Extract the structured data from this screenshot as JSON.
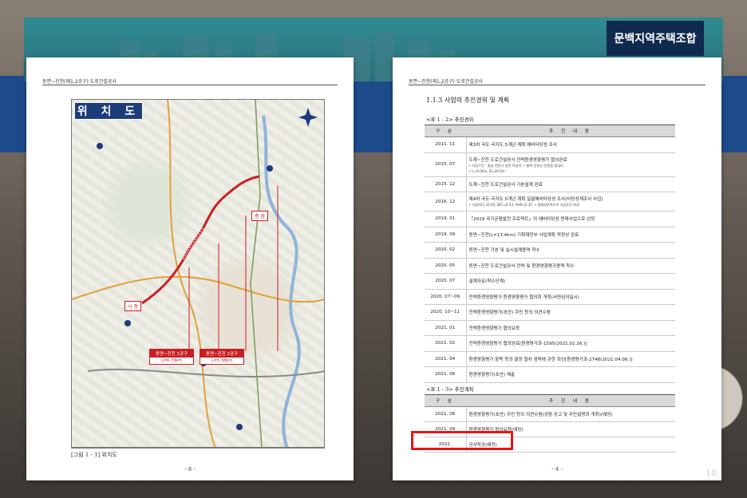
{
  "brand": "문백지역주택조합",
  "slide_number": "18",
  "left_page": {
    "header": "동면~진천(제1,2공구) 도로건설공사",
    "map_title": "위 치 도",
    "labels": {
      "start": "시 점",
      "end": "종 점",
      "section1": "동면~진천 1공구",
      "section1_len": "L=6.70km",
      "section2": "동면~진천 2공구",
      "section2_len": "L=5.38km"
    },
    "caption": "[그림 1 - 1] 위치도",
    "page_num": "- 8 -"
  },
  "right_page": {
    "header": "동면~진천(제1,2공구) 도로건설공사",
    "section_title": "1.1.3 사업의 추진경위 및 계획",
    "table1_label": "<표 1 - 2> 추진경위",
    "table2_label": "<표 1 - 3> 추진계획",
    "col_date": "구 분",
    "col_content": "추 진 내 용",
    "history": [
      {
        "date": "2011. 11",
        "text": "제3차 국도·국지도 5개년 계획 예비타당성 조사"
      },
      {
        "date": "2015. 07",
        "text": "도계~진천 도로건설공사 전략환경영향평가 협의완료",
        "sub1": "• 사업구간 : 충남 천안시 동면 덕성리 ~ 충북 진천군 진천읍 옵내리",
        "sub2": "• L=9.0km, B=20.0m"
      },
      {
        "date": "2015. 12",
        "text": "도계~진천 도로건설공사 기본설계 완료"
      },
      {
        "date": "2016. 12",
        "text": "제4차 국도·국지도 5개년 계획 일괄예비타당성 조사(타당성재조사 사업)",
        "sub1": "• 사업비(1,313억, B/C=0.53, AHP=0.35 → 경제성부족으로 사업추진 보류"
      },
      {
        "date": "2019. 01",
        "text": "「2019 국가균형발전 프로젝트」의 예비타당성 면제사업으로 선정"
      },
      {
        "date": "2019. 09",
        "text": "동면~진천(L=13.4km) 기획재정부 사업계획 적정성 완료"
      },
      {
        "date": "2020. 02",
        "text": "동면~진천 기본 및 실시설계용역 착수"
      },
      {
        "date": "2020. 05",
        "text": "동면~진천 도로건설공사 전략 및 환경영향평가용역 착수"
      },
      {
        "date": "2020. 07",
        "text": "설계자문(착수단계)"
      },
      {
        "date": "2020. 07~09",
        "text": "전략환경영향평가 환경영향평가 협의회 개최(서면심의실시)"
      },
      {
        "date": "2020. 10~11",
        "text": "전략환경영향평가(초안) 주민 등의 의견수렴"
      },
      {
        "date": "2021. 01",
        "text": "전략환경영향평가 협의요청"
      },
      {
        "date": "2021. 02",
        "text": "전략환경영향평가 협의완료[환경평가과-1595(2021.02.26.)]"
      },
      {
        "date": "2021. 04",
        "text": "환경영향평가 항목 등의 결정 절차 생략에 관한 회신[환경평가과-2748(2021.04.06.)]"
      },
      {
        "date": "2021. 06",
        "text": "환경영향평가(초안) 제출"
      }
    ],
    "plan": [
      {
        "date": "2021. 06",
        "text": "환경영향평가(초안) 주민 등의 의견수렴(공람·공고 및 주민설명회 개최)(예정)"
      },
      {
        "date": "2021. 09",
        "text": "환경영향평가 협의요청(예정)"
      },
      {
        "date": "2022.",
        "text": "공사착공(예정)"
      }
    ],
    "page_num": "- 4 -"
  }
}
